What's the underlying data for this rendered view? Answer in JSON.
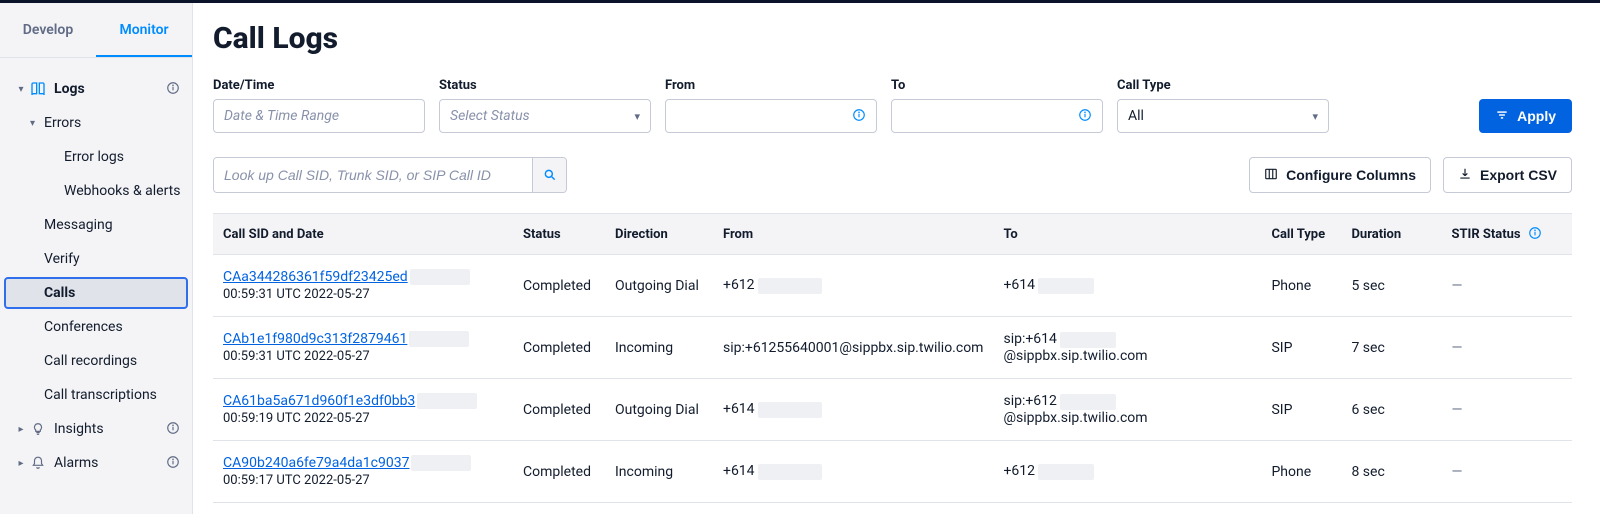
{
  "sidebar": {
    "tabs": {
      "develop": "Develop",
      "monitor": "Monitor"
    },
    "logs": "Logs",
    "errors": "Errors",
    "error_logs": "Error logs",
    "webhooks": "Webhooks & alerts",
    "messaging": "Messaging",
    "verify": "Verify",
    "calls": "Calls",
    "conferences": "Conferences",
    "call_recordings": "Call recordings",
    "call_transcriptions": "Call transcriptions",
    "insights": "Insights",
    "alarms": "Alarms"
  },
  "page": {
    "title": "Call Logs",
    "filters": {
      "date_label": "Date/Time",
      "date_placeholder": "Date & Time Range",
      "status_label": "Status",
      "status_placeholder": "Select Status",
      "from_label": "From",
      "to_label": "To",
      "calltype_label": "Call Type",
      "calltype_value": "All",
      "apply": "Apply"
    },
    "lookup_placeholder": "Look up Call SID, Trunk SID, or SIP Call ID",
    "configure_columns": "Configure Columns",
    "export_csv": "Export CSV"
  },
  "table": {
    "headers": {
      "sid": "Call SID and Date",
      "status": "Status",
      "direction": "Direction",
      "from": "From",
      "to": "To",
      "calltype": "Call Type",
      "duration": "Duration",
      "stir": "STIR Status"
    },
    "rows": [
      {
        "sid": "CAa344286361f59df23425ed",
        "date": "00:59:31 UTC 2022-05-27",
        "status": "Completed",
        "direction": "Outgoing Dial",
        "from_prefix": "+612",
        "from_suffix": "",
        "to_prefix": "+614",
        "to_suffix": "",
        "calltype": "Phone",
        "duration": "5 sec",
        "stir": "—"
      },
      {
        "sid": "CAb1e1f980d9c313f2879461",
        "date": "00:59:31 UTC 2022-05-27",
        "status": "Completed",
        "direction": "Incoming",
        "from_prefix": "sip:+61255640001@sippbx.sip.twilio.com",
        "from_suffix": "",
        "to_prefix": "sip:+614",
        "to_suffix": "@sippbx.sip.twilio.com",
        "calltype": "SIP",
        "duration": "7 sec",
        "stir": "—"
      },
      {
        "sid": "CA61ba5a671d960f1e3df0bb3",
        "date": "00:59:19 UTC 2022-05-27",
        "status": "Completed",
        "direction": "Outgoing Dial",
        "from_prefix": "+614",
        "from_suffix": "",
        "to_prefix": "sip:+612",
        "to_suffix": "@sippbx.sip.twilio.com",
        "calltype": "SIP",
        "duration": "6 sec",
        "stir": "—"
      },
      {
        "sid": "CA90b240a6fe79a4da1c9037",
        "date": "00:59:17 UTC 2022-05-27",
        "status": "Completed",
        "direction": "Incoming",
        "from_prefix": "+614",
        "from_suffix": "",
        "to_prefix": "+612",
        "to_suffix": "",
        "calltype": "Phone",
        "duration": "8 sec",
        "stir": "—"
      }
    ]
  }
}
